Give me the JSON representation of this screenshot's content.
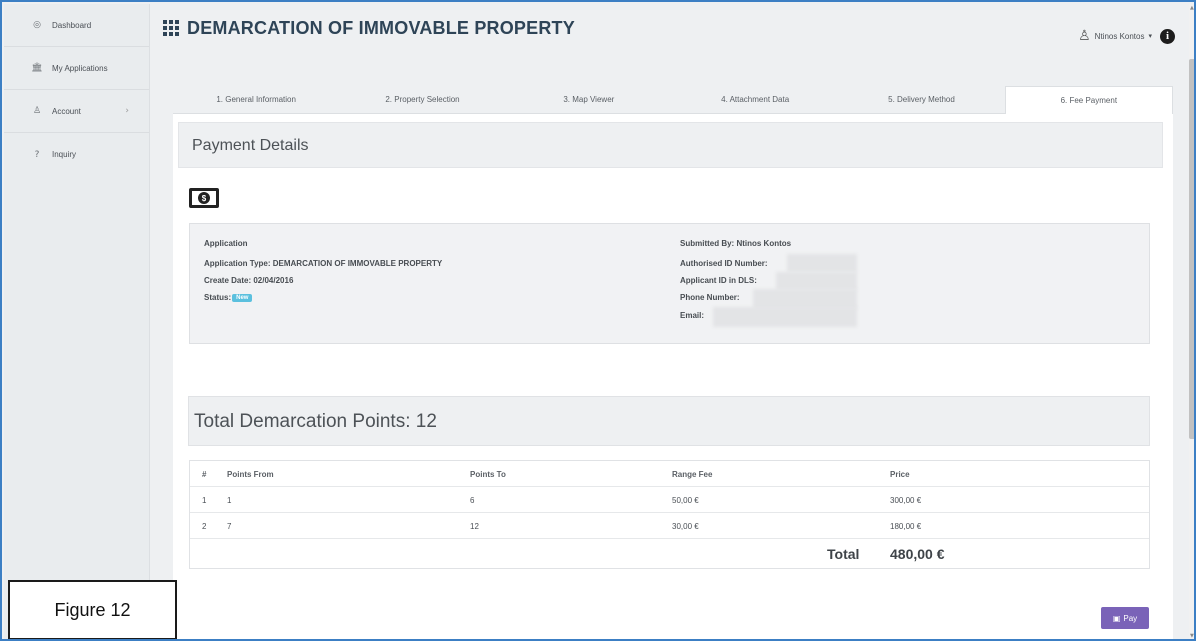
{
  "sidebar": {
    "items": [
      {
        "icon": "dashboard-icon",
        "glyph": "◎",
        "label": "Dashboard"
      },
      {
        "icon": "applications-icon",
        "glyph": "🏛",
        "label": "My Applications"
      },
      {
        "icon": "account-icon",
        "glyph": "♙",
        "label": "Account",
        "chevron": "›"
      },
      {
        "icon": "inquiry-icon",
        "glyph": "?",
        "label": "Inquiry"
      }
    ]
  },
  "header": {
    "title": "DEMARCATION OF IMMOVABLE PROPERTY",
    "user_name": "Ntinos Kontos",
    "user_caret": "▾",
    "info_glyph": "i"
  },
  "tabs": [
    {
      "label": "1. General Information",
      "active": false
    },
    {
      "label": "2. Property Selection",
      "active": false
    },
    {
      "label": "3. Map Viewer",
      "active": false
    },
    {
      "label": "4. Attachment Data",
      "active": false
    },
    {
      "label": "5. Delivery Method",
      "active": false
    },
    {
      "label": "6. Fee Payment",
      "active": true
    }
  ],
  "payment": {
    "title": "Payment Details",
    "application": {
      "heading": "Application",
      "type_line": "Application Type: DEMARCATION OF IMMOVABLE PROPERTY",
      "create_date_line": "Create Date: 02/04/2016",
      "status_label": "Status:",
      "status_value": "New",
      "submitted_by_line": "Submitted By: Ntinos Kontos",
      "authorised_id_label": "Authorised ID Number:",
      "applicant_id_label": "Applicant ID in DLS:",
      "phone_label": "Phone Number:",
      "email_label": "Email:"
    }
  },
  "points": {
    "title": "Total Demarcation Points: 12"
  },
  "fee_table": {
    "headers": [
      "#",
      "Points From",
      "Points To",
      "Range Fee",
      "Price"
    ],
    "rows": [
      [
        "1",
        "1",
        "6",
        "50,00 €",
        "300,00 €"
      ],
      [
        "2",
        "7",
        "12",
        "30,00 €",
        "180,00 €"
      ]
    ],
    "total_label": "Total",
    "total_value": "480,00 €"
  },
  "pay_button": {
    "label": "Pay",
    "icon_glyph": "▣"
  },
  "figure_caption": "Figure 12",
  "colors": {
    "title": "#2e4457",
    "status_badge": "#5bc0de",
    "pay_button": "#7a63b8",
    "frame_border": "#3c7fc4"
  }
}
